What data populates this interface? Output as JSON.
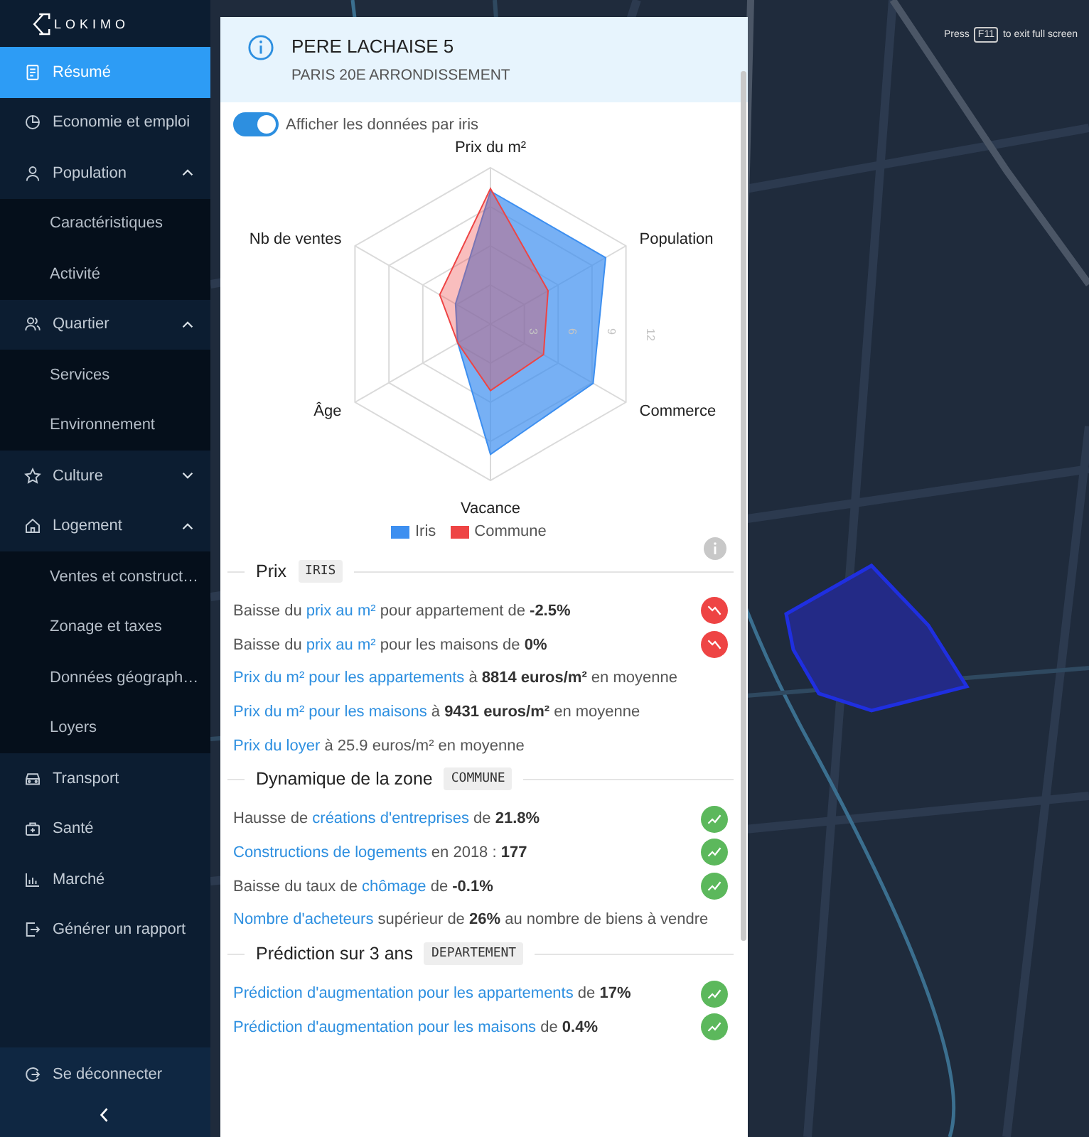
{
  "sidebar": {
    "logo": "LOKIMO",
    "items": [
      {
        "label": "Résumé",
        "selected": true
      },
      {
        "label": "Economie et emploi",
        "selected": false
      },
      {
        "label": "Population",
        "selected": false,
        "expanded": true,
        "children": [
          {
            "label": "Caractéristiques",
            "selected": false
          },
          {
            "label": "Activité",
            "selected": false
          }
        ]
      },
      {
        "label": "Quartier",
        "selected": false,
        "expanded": true,
        "children": [
          {
            "label": "Services",
            "selected": false
          },
          {
            "label": "Environnement",
            "selected": false
          }
        ]
      },
      {
        "label": "Culture",
        "selected": false,
        "expanded": false
      },
      {
        "label": "Logement",
        "selected": false,
        "expanded": true,
        "children": [
          {
            "label": "Ventes et construct…",
            "selected": false
          },
          {
            "label": "Zonage et taxes",
            "selected": false
          },
          {
            "label": "Données géograph…",
            "selected": false
          },
          {
            "label": "Loyers",
            "selected": false
          }
        ]
      },
      {
        "label": "Transport",
        "selected": false
      },
      {
        "label": "Santé",
        "selected": false
      },
      {
        "label": "Marché",
        "selected": false
      },
      {
        "label": "Générer un rapport",
        "selected": false
      }
    ],
    "logout": "Se déconnecter"
  },
  "map": {
    "kind": "picture",
    "notice": {
      "before": "Press",
      "key": "F11",
      "after": "to exit full screen"
    }
  },
  "panel": {
    "title": "PERE LACHAISE 5",
    "subtitle": "PARIS 20E ARRONDISSEMENT",
    "toggle": {
      "label": "Afficher les données par iris",
      "on": true
    },
    "chart_data": {
      "type": "radar",
      "legend": true,
      "categories": [
        "Prix du m²",
        "Population",
        "Commerce",
        "Vacance",
        "Âge",
        "Nb de ventes"
      ],
      "ylim": [
        0,
        12
      ],
      "yticks": [
        3,
        6,
        9,
        12
      ],
      "series": [
        {
          "name": "Iris",
          "color": "#3d8ff0",
          "values": [
            10.2,
            10.2,
            9.1,
            10,
            2.9,
            3.1
          ]
        },
        {
          "name": "Commune",
          "color": "#ee4444",
          "values": [
            10.4,
            5.1,
            4.7,
            5.1,
            2.9,
            4.5
          ]
        }
      ]
    },
    "sections": [
      {
        "title": "Prix",
        "badge": "IRIS",
        "rows": [
          {
            "kind": "down",
            "parts": [
              {
                "kind": "text",
                "text": "Baisse du "
              },
              {
                "kind": "link",
                "text": "prix au m²"
              },
              {
                "kind": "text",
                "text": " pour appartement de "
              },
              {
                "kind": "bold",
                "text": "-2.5%"
              }
            ]
          },
          {
            "kind": "down",
            "parts": [
              {
                "kind": "text",
                "text": "Baisse du "
              },
              {
                "kind": "link",
                "text": "prix au m²"
              },
              {
                "kind": "text",
                "text": " pour les maisons de "
              },
              {
                "kind": "bold",
                "text": "0%"
              }
            ]
          },
          {
            "parts": [
              {
                "kind": "link",
                "text": "Prix du m² pour les appartements"
              },
              {
                "kind": "text",
                "text": " à "
              },
              {
                "kind": "bold",
                "text": "8814 euros/m²"
              },
              {
                "kind": "text",
                "text": " en moyenne"
              }
            ]
          },
          {
            "parts": [
              {
                "kind": "link",
                "text": "Prix du m² pour les maisons"
              },
              {
                "kind": "text",
                "text": " à "
              },
              {
                "kind": "bold",
                "text": "9431 euros/m²"
              },
              {
                "kind": "text",
                "text": " en moyenne"
              }
            ]
          },
          {
            "parts": [
              {
                "kind": "link",
                "text": "Prix du loyer"
              },
              {
                "kind": "text",
                "text": " à 25.9 euros/m² en moyenne"
              }
            ]
          }
        ]
      },
      {
        "title": "Dynamique de la zone",
        "badge": "COMMUNE",
        "rows": [
          {
            "kind": "up",
            "parts": [
              {
                "kind": "text",
                "text": "Hausse de "
              },
              {
                "kind": "link",
                "text": "créations d'entreprises"
              },
              {
                "kind": "text",
                "text": " de "
              },
              {
                "kind": "bold",
                "text": "21.8%"
              }
            ]
          },
          {
            "kind": "up",
            "parts": [
              {
                "kind": "link",
                "text": "Constructions de logements"
              },
              {
                "kind": "text",
                "text": " en 2018 : "
              },
              {
                "kind": "bold",
                "text": "177"
              }
            ]
          },
          {
            "kind": "up",
            "parts": [
              {
                "kind": "text",
                "text": "Baisse du taux de "
              },
              {
                "kind": "link",
                "text": "chômage"
              },
              {
                "kind": "text",
                "text": " de "
              },
              {
                "kind": "bold",
                "text": "-0.1%"
              }
            ]
          },
          {
            "parts": [
              {
                "kind": "link",
                "text": "Nombre d'acheteurs"
              },
              {
                "kind": "text",
                "text": " supérieur de "
              },
              {
                "kind": "bold",
                "text": "26%"
              },
              {
                "kind": "text",
                "text": " au nombre de biens à vendre"
              }
            ]
          }
        ]
      },
      {
        "title": "Prédiction sur 3 ans",
        "badge": "DEPARTEMENT",
        "rows": [
          {
            "kind": "up",
            "parts": [
              {
                "kind": "link",
                "text": "Prédiction d'augmentation pour les appartements"
              },
              {
                "kind": "text",
                "text": " de "
              },
              {
                "kind": "bold",
                "text": "17%"
              }
            ]
          },
          {
            "kind": "up",
            "parts": [
              {
                "kind": "link",
                "text": "Prédiction d'augmentation pour les maisons"
              },
              {
                "kind": "text",
                "text": " de "
              },
              {
                "kind": "bold",
                "text": "0.4%"
              }
            ]
          }
        ]
      }
    ]
  }
}
